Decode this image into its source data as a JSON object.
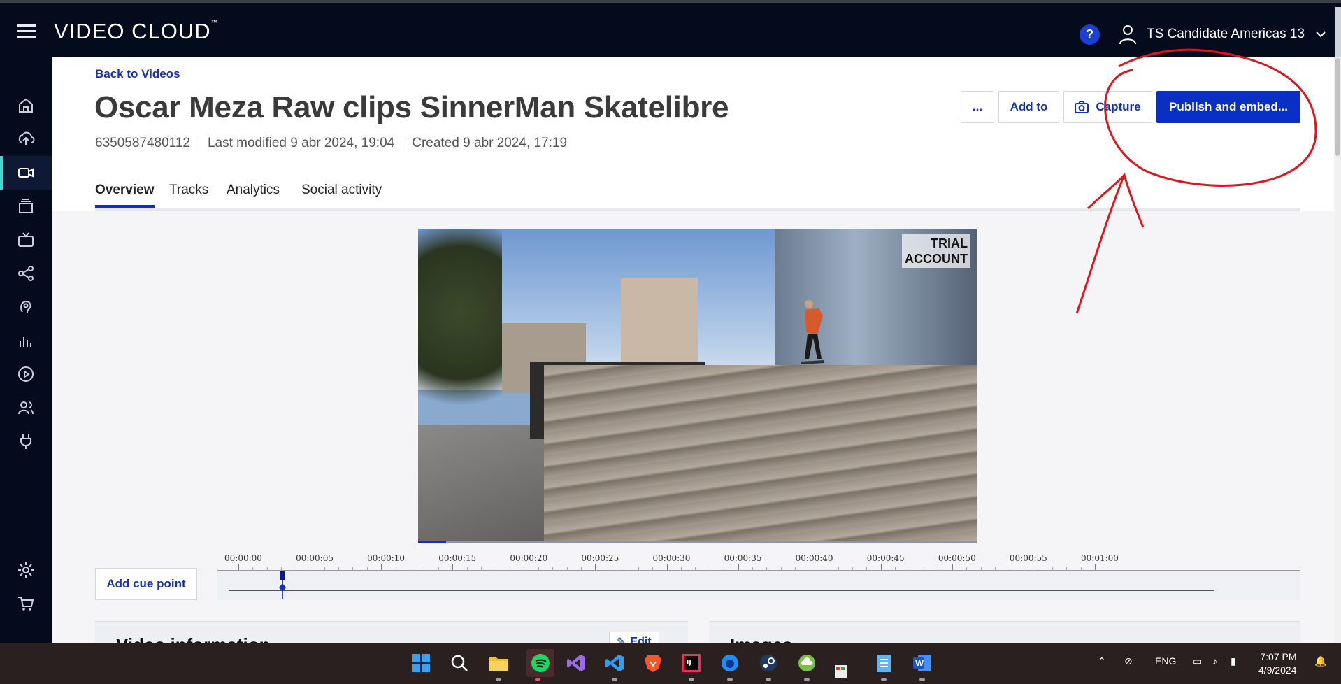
{
  "header": {
    "brand": "VIDEO CLOUD",
    "brand_mark": "™",
    "help": "?",
    "account_name": "TS Candidate Americas 13"
  },
  "nav": {
    "items": [
      "home-icon",
      "upload-icon",
      "videos-icon",
      "playlists-icon",
      "live-icon",
      "social-icon",
      "audience-icon",
      "analytics-icon",
      "players-icon",
      "users-icon",
      "plugins-icon",
      "settings-icon",
      "cart-icon"
    ],
    "active": "videos-icon"
  },
  "page": {
    "back_link": "Back to Videos",
    "title": "Oscar Meza Raw clips SinnerMan Skatelibre",
    "video_id": "6350587480112",
    "last_modified": "Last modified 9 abr 2024, 19:04",
    "created": "Created 9 abr 2024, 17:19"
  },
  "actions": {
    "more": "...",
    "add_to": "Add to",
    "capture": "Capture",
    "publish": "Publish and embed..."
  },
  "tabs": [
    {
      "label": "Overview",
      "active": true
    },
    {
      "label": "Tracks",
      "active": false
    },
    {
      "label": "Analytics",
      "active": false
    },
    {
      "label": "Social activity",
      "active": false
    }
  ],
  "video": {
    "watermark_line1": "TRIAL",
    "watermark_line2": "ACCOUNT",
    "progress_fraction": 0.05
  },
  "timeline": {
    "add_cue_label": "Add cue point",
    "ticks": [
      "00:00:00",
      "00:00:05",
      "00:00:10",
      "00:00:15",
      "00:00:20",
      "00:00:25",
      "00:00:30",
      "00:00:35",
      "00:00:40",
      "00:00:45",
      "00:00:50",
      "00:00:55",
      "00:01:00"
    ],
    "playhead_seconds": 3.1
  },
  "cards": {
    "video_info_title": "Video information",
    "edit_label": "Edit",
    "images_title": "Images"
  },
  "taskbar": {
    "apps": [
      "windows-start-icon",
      "search-icon",
      "file-explorer-icon",
      "spotify-icon",
      "visual-studio-icon",
      "vscode-icon",
      "brave-icon",
      "intellij-icon",
      "firefox-icon",
      "steam-icon",
      "cloud-app-icon",
      "paint-icon",
      "notepad-icon",
      "word-icon"
    ],
    "lang": "ENG",
    "time": "7:07 PM",
    "date": "4/9/2024"
  },
  "colors": {
    "header_bg": "#040b1c",
    "accent_blue": "#0a2fc4",
    "link_blue": "#1530b8",
    "nav_active": "#3bd7d3",
    "annotation_red": "#e0141e"
  }
}
